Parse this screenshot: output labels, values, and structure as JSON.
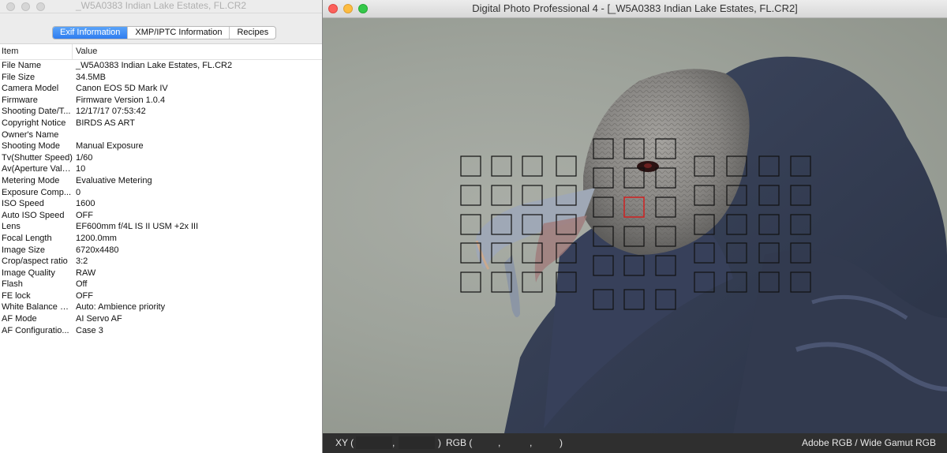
{
  "info_window": {
    "title": "_W5A0383  Indian Lake Estates, FL.CR2",
    "tabs": [
      {
        "label": "Exif Information",
        "active": true
      },
      {
        "label": "XMP/IPTC Information",
        "active": false
      },
      {
        "label": "Recipes",
        "active": false
      }
    ],
    "table": {
      "headers": [
        "Item",
        "Value"
      ],
      "rows": [
        [
          "File Name",
          "_W5A0383  Indian Lake Estates, FL.CR2"
        ],
        [
          "File Size",
          "34.5MB"
        ],
        [
          "Camera Model",
          "Canon EOS 5D Mark IV"
        ],
        [
          "Firmware",
          "Firmware Version 1.0.4"
        ],
        [
          "Shooting Date/T...",
          "12/17/17 07:53:42"
        ],
        [
          "Copyright Notice",
          "BIRDS AS ART"
        ],
        [
          "Owner's Name",
          ""
        ],
        [
          "Shooting Mode",
          "Manual Exposure"
        ],
        [
          "Tv(Shutter Speed)",
          "1/60"
        ],
        [
          "Av(Aperture Value)",
          "10"
        ],
        [
          "Metering Mode",
          "Evaluative Metering"
        ],
        [
          "Exposure Comp...",
          "0"
        ],
        [
          "ISO Speed",
          "1600"
        ],
        [
          "Auto ISO Speed",
          "OFF"
        ],
        [
          "Lens",
          "EF600mm f/4L IS II USM +2x III"
        ],
        [
          "Focal Length",
          "1200.0mm"
        ],
        [
          "Image Size",
          "6720x4480"
        ],
        [
          "Crop/aspect ratio",
          "3:2"
        ],
        [
          "Image Quality",
          "RAW"
        ],
        [
          "Flash",
          "Off"
        ],
        [
          "FE lock",
          "OFF"
        ],
        [
          "White Balance M...",
          "Auto: Ambience priority"
        ],
        [
          "AF Mode",
          "AI Servo AF"
        ],
        [
          "AF Configuratio...",
          "Case 3"
        ]
      ]
    }
  },
  "dpp_window": {
    "title": "Digital Photo Professional 4 - [_W5A0383  Indian Lake Estates, FL.CR2]",
    "photo_subject": "black vulture head close-up",
    "af_points": {
      "active_point": "center",
      "active_color": "#d02020",
      "inactive_color": "#111111"
    },
    "status_bar": {
      "xy_label": "XY (",
      "xy_comma": ",",
      "xy_close": ")",
      "rgb_label": "RGB (",
      "rgb_comma1": ",",
      "rgb_comma2": ",",
      "rgb_close": ")",
      "color_space": "Adobe RGB / Wide Gamut RGB"
    }
  }
}
